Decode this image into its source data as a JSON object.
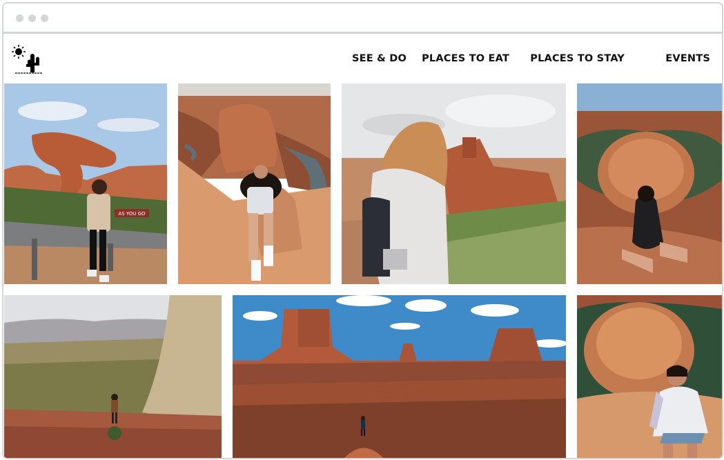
{
  "browser": {
    "controls": [
      "close",
      "minimize",
      "maximize"
    ]
  },
  "logo": {
    "icon": "sun-cactus-icon"
  },
  "nav": {
    "items": [
      {
        "label": "SEE & DO"
      },
      {
        "label": "PLACES TO EAT"
      },
      {
        "label": "PLACES TO STAY"
      },
      {
        "label": "EVENTS"
      }
    ]
  },
  "gallery": {
    "photos": [
      {
        "id": "photo-rock-arch-roadside",
        "sign_text": "AS YOU GO"
      },
      {
        "id": "photo-canyon-cliff-sitting"
      },
      {
        "id": "photo-pueblo-ruins"
      },
      {
        "id": "photo-horseshoe-bend-back"
      },
      {
        "id": "photo-sedona-valley-hiker"
      },
      {
        "id": "photo-monument-valley-buttes"
      },
      {
        "id": "photo-horseshoe-bend-smile"
      }
    ]
  },
  "colors": {
    "nav_text": "#111111",
    "window_border": "#d3d6d6",
    "sandstone": "#c8643f"
  }
}
